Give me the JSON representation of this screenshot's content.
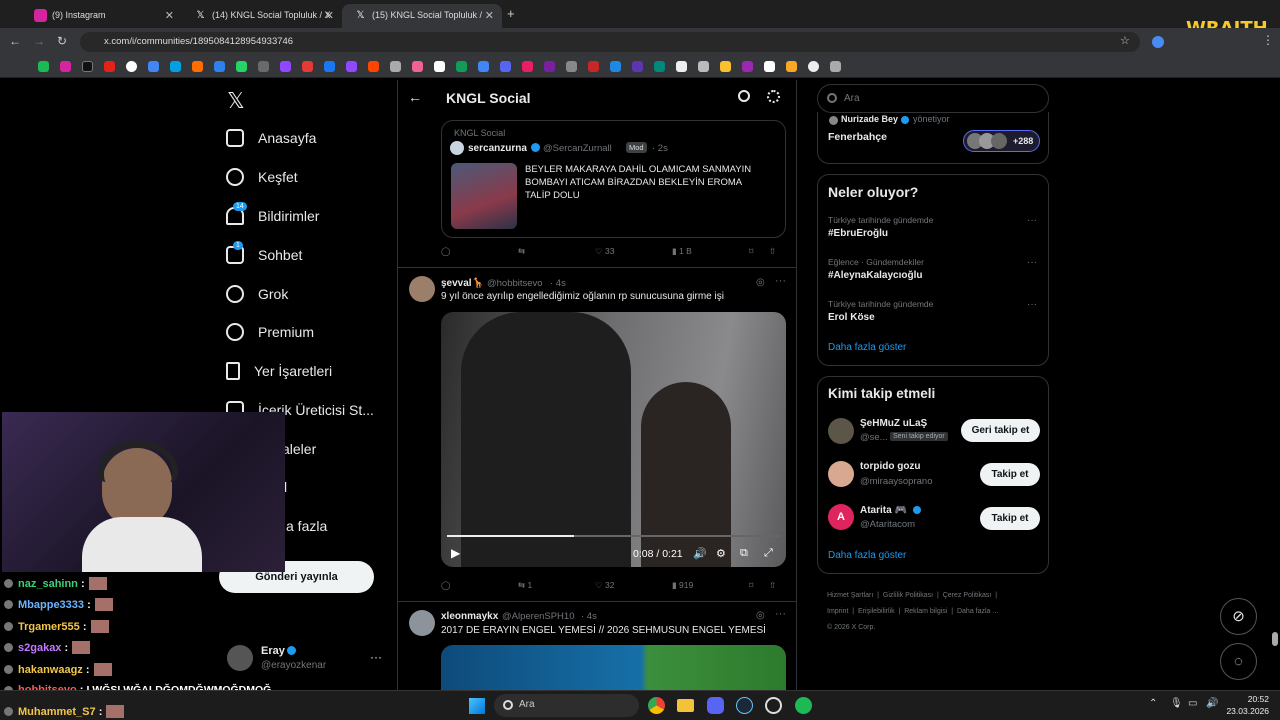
{
  "browser": {
    "tabs": [
      {
        "label": "(9) Instagram",
        "icon": "instagram-icon"
      },
      {
        "label": "(14) KNGL Social Topluluk / X",
        "icon": "x-icon"
      },
      {
        "label": "(15) KNGL Social Topluluk /",
        "icon": "x-icon"
      }
    ],
    "new_tab": "+",
    "url": "x.com/i/communities/1895084128954933746",
    "overlay_logo": "WRAITH"
  },
  "nav": {
    "items": [
      {
        "label": "Anasayfa",
        "icon": "home-icon"
      },
      {
        "label": "Keşfet",
        "icon": "search-icon"
      },
      {
        "label": "Bildirimler",
        "icon": "bell-icon",
        "badge": "14"
      },
      {
        "label": "Sohbet",
        "icon": "mail-icon",
        "badge": "1"
      },
      {
        "label": "Grok",
        "icon": "grok-icon"
      },
      {
        "label": "Premium",
        "icon": "premium-icon"
      },
      {
        "label": "Yer İşaretleri",
        "icon": "bookmark-icon"
      },
      {
        "label": "İçerik Üreticisi St...",
        "icon": "creator-icon"
      },
      {
        "label": "aleler",
        "icon": "article-icon"
      },
      {
        "label": "l",
        "icon": "profile-icon"
      },
      {
        "label": "a fazla",
        "icon": "more-icon"
      }
    ],
    "post_button": "Gönderi yayınla",
    "account": {
      "name": "Eray",
      "handle": "@erayozkenar",
      "menu": "···"
    }
  },
  "header": {
    "title": "KNGL Social"
  },
  "posts": [
    {
      "community": "KNGL Social",
      "author": "sercanzurna",
      "handle": "@SercanZurnall",
      "role": "Mod",
      "time": "· 2s",
      "text": "BEYLER MAKARAYA DAHİL OLAMICAM SANMAYIN BOMBAYI ATICAM BİRAZDAN BEKLEYİN EROMA TALİP DOLU",
      "replies": "",
      "reposts": "",
      "likes": "33",
      "views": "1 B"
    },
    {
      "author": "şevval🦒",
      "handle": "@hobbitsevo",
      "time": "· 4s",
      "text": "9 yıl önce ayrılıp engellediğimiz oğlanın rp sunucusuna girme işi",
      "video_time": "0:08 / 0:21",
      "video_progress": 0.38,
      "replies": "",
      "reposts": "1",
      "likes": "32",
      "views": "919"
    },
    {
      "author": "xleonmaykx",
      "handle": "@AlperenSPH10",
      "time": "· 4s",
      "text": "2017 DE ERAYIN ENGEL YEMESİ // 2026 SEHMUSUN ENGEL YEMESİ"
    }
  ],
  "search": {
    "placeholder": "Ara"
  },
  "community_box": {
    "mod_name": "Nurizade Bey",
    "mod_role": "yönetiyor",
    "name": "Fenerbahçe",
    "members": "+288"
  },
  "trends": {
    "title": "Neler oluyor?",
    "items": [
      {
        "context": "Türkiye tarihinde gündemde",
        "name": "#EbruEroğlu"
      },
      {
        "context": "Eğlence · Gündemdekiler",
        "name": "#AleynaKalaycıoğlu"
      },
      {
        "context": "Türkiye tarihinde gündemde",
        "name": "Erol Köse"
      }
    ],
    "more": "Daha fazla göster"
  },
  "follow": {
    "title": "Kimi takip etmeli",
    "items": [
      {
        "name": "ŞeHMuZ uLaŞ",
        "handle": "@se...",
        "tag": "Seni takip ediyor",
        "button": "Geri takip et"
      },
      {
        "name": "torpido gozu",
        "handle": "@miraaysoprano",
        "tag": "",
        "button": "Takip et"
      },
      {
        "name": "Atarita 🎮",
        "handle": "@Ataritacom",
        "tag": "",
        "button": "Takip et"
      }
    ],
    "more": "Daha fazla göster"
  },
  "footer": {
    "links": [
      "Hizmet Şartları",
      "Gizlilik Politikası",
      "Çerez Politikası",
      "Imprint",
      "Erişilebilirlik",
      "Reklam bilgisi",
      "Daha fazla ..."
    ],
    "copyright": "© 2026 X Corp."
  },
  "chat": [
    {
      "user": "naz_sahinn",
      "color": "#3ccf7a",
      "msg": ""
    },
    {
      "user": "Mbappe3333",
      "color": "#6cb4ff",
      "msg": ""
    },
    {
      "user": "Trgamer555",
      "color": "#f3c64a",
      "msg": ""
    },
    {
      "user": "s2gakax",
      "color": "#c17bff",
      "msg": ""
    },
    {
      "user": "hakanwaagz",
      "color": "#f3c64a",
      "msg": ""
    },
    {
      "user": "hobbitsevo",
      "color": "#ff5a5a",
      "msg": "LWĞSLWĞALDĞQMDĞWMQĞDMQĞ"
    },
    {
      "user": "Muhammet_S7",
      "color": "#f3c64a",
      "msg": ""
    }
  ],
  "taskbar": {
    "search": "Ara",
    "time": "20:52",
    "date": "23.03.2026"
  }
}
